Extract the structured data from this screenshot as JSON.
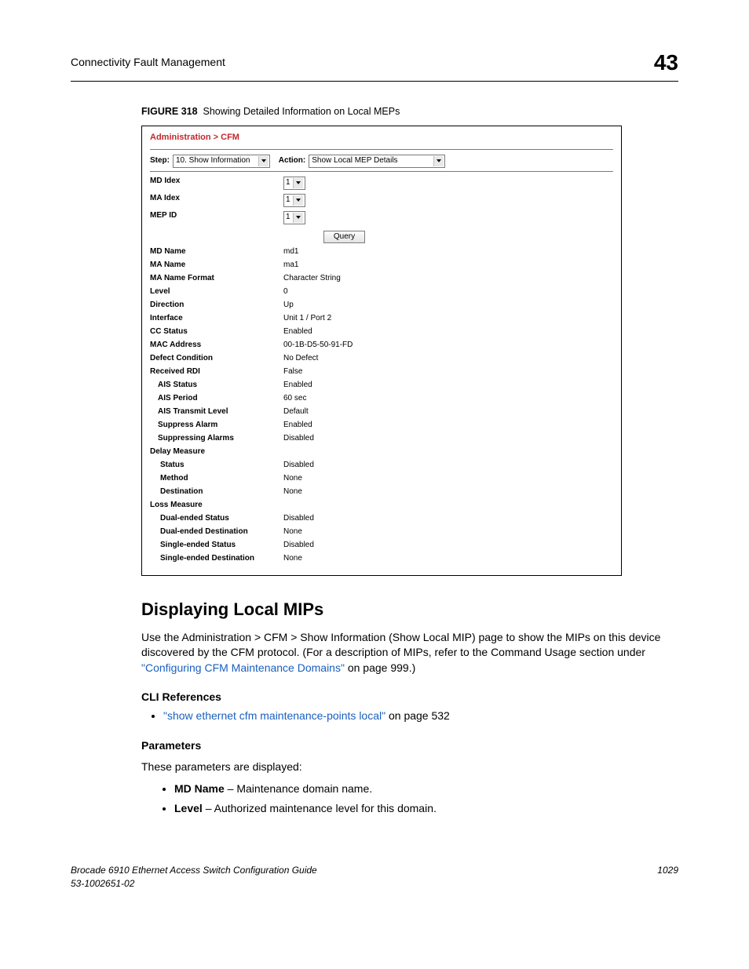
{
  "header": {
    "title": "Connectivity Fault Management",
    "chapter": "43"
  },
  "figure": {
    "num": "FIGURE 318",
    "caption": "Showing Detailed Information on Local MEPs"
  },
  "screenshot": {
    "breadcrumb": "Administration > CFM",
    "step_label": "Step:",
    "step_value": "10. Show Information",
    "action_label": "Action:",
    "action_value": "Show Local MEP Details",
    "inputs": {
      "md_idex": {
        "label": "MD Idex",
        "value": "1"
      },
      "ma_idex": {
        "label": "MA Idex",
        "value": "1"
      },
      "mep_id": {
        "label": "MEP ID",
        "value": "1"
      }
    },
    "query_btn": "Query",
    "rows": [
      {
        "label": "MD Name",
        "value": "md1"
      },
      {
        "label": "MA Name",
        "value": "ma1"
      },
      {
        "label": "MA Name Format",
        "value": "Character String"
      },
      {
        "label": "Level",
        "value": "0"
      },
      {
        "label": "Direction",
        "value": "Up"
      },
      {
        "label": "Interface",
        "value": "Unit 1 / Port 2"
      },
      {
        "label": "CC Status",
        "value": "Enabled"
      },
      {
        "label": "MAC Address",
        "value": "00-1B-D5-50-91-FD"
      },
      {
        "label": "Defect Condition",
        "value": "No Defect"
      },
      {
        "label": "Received RDI",
        "value": "False"
      },
      {
        "label": "AIS Status",
        "value": "Enabled",
        "sub": true
      },
      {
        "label": "AIS Period",
        "value": "60 sec",
        "sub": true
      },
      {
        "label": "AIS Transmit Level",
        "value": "Default",
        "sub": true
      },
      {
        "label": "Suppress Alarm",
        "value": "Enabled",
        "sub": true
      },
      {
        "label": "Suppressing Alarms",
        "value": "Disabled",
        "sub": true
      },
      {
        "label": "Delay Measure",
        "value": ""
      },
      {
        "label": "Status",
        "value": "Disabled",
        "sub2": true
      },
      {
        "label": "Method",
        "value": "None",
        "sub2": true
      },
      {
        "label": "Destination",
        "value": "None",
        "sub2": true
      },
      {
        "label": "Loss Measure",
        "value": ""
      },
      {
        "label": "Dual-ended Status",
        "value": "Disabled",
        "sub2": true
      },
      {
        "label": "Dual-ended Destination",
        "value": "None",
        "sub2": true
      },
      {
        "label": "Single-ended Status",
        "value": "Disabled",
        "sub2": true
      },
      {
        "label": "Single-ended Destination",
        "value": "None",
        "sub2": true
      }
    ]
  },
  "section": {
    "heading": "Displaying Local MIPs",
    "intro_a": "Use the Administration > CFM > Show Information (Show Local MIP) page to show the MIPs on this device discovered by the CFM protocol. (For a description of MIPs, refer to the Command Usage section under ",
    "intro_link": "\"Configuring CFM Maintenance Domains\"",
    "intro_b": " on page 999.)",
    "cli_head": "CLI References",
    "cli_link": "\"show ethernet cfm maintenance-points local\"",
    "cli_tail": " on page 532",
    "params_head": "Parameters",
    "params_intro": "These parameters are displayed:",
    "params": [
      {
        "name": "MD Name",
        "desc": " – Maintenance domain name."
      },
      {
        "name": "Level",
        "desc": " – Authorized maintenance level for this domain."
      }
    ]
  },
  "footer": {
    "line1": "Brocade 6910 Ethernet Access Switch Configuration Guide",
    "line2": "53-1002651-02",
    "page": "1029"
  }
}
